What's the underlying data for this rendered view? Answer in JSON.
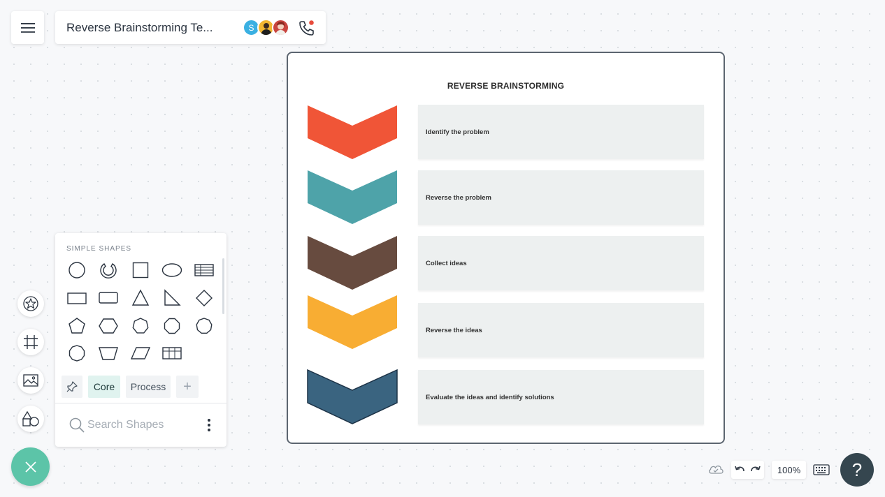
{
  "header": {
    "title": "Reverse Brainstorming Te...",
    "collaborators": [
      {
        "initial": "S",
        "color": "#3ab0e2"
      },
      {
        "initial": "",
        "color": "#f2b632"
      },
      {
        "initial": "",
        "color": "#c9453f"
      }
    ]
  },
  "diagram": {
    "title": "REVERSE BRAINSTORMING",
    "steps": [
      {
        "label": "Identify the problem",
        "color": "#f05537"
      },
      {
        "label": "Reverse the problem",
        "color": "#4ea3a9"
      },
      {
        "label": "Collect ideas",
        "color": "#674b3f"
      },
      {
        "label": "Reverse the ideas",
        "color": "#f8ad33"
      },
      {
        "label": "Evaluate the ideas and identify solutions",
        "color": "#3a6480"
      }
    ]
  },
  "shapes_panel": {
    "heading": "SIMPLE SHAPES",
    "shapes": [
      "circle",
      "partial-circle",
      "square",
      "ellipse",
      "table-lines",
      "rectangle",
      "rounded-rectangle",
      "triangle",
      "right-triangle",
      "diamond",
      "pentagon",
      "hexagon",
      "heptagon",
      "octagon",
      "nonagon",
      "decagon",
      "trapezoid",
      "parallelogram",
      "table-grid"
    ],
    "tabs": {
      "core": "Core",
      "process": "Process",
      "add": "+"
    },
    "search_placeholder": "Search Shapes"
  },
  "footer": {
    "zoom": "100%",
    "help": "?"
  },
  "colors": {
    "accent": "#5cc4a8",
    "help_bg": "#35464f"
  }
}
